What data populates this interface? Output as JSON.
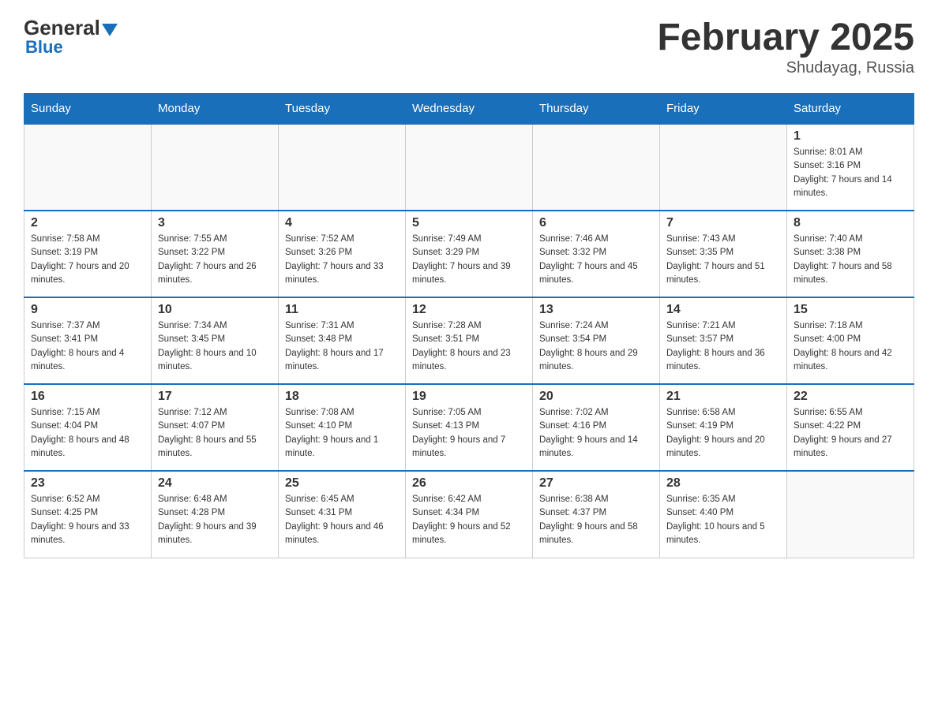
{
  "header": {
    "logo": {
      "general": "General",
      "blue": "Blue",
      "underline": "Blue"
    },
    "title": "February 2025",
    "location": "Shudayag, Russia"
  },
  "days_of_week": [
    "Sunday",
    "Monday",
    "Tuesday",
    "Wednesday",
    "Thursday",
    "Friday",
    "Saturday"
  ],
  "weeks": [
    [
      null,
      null,
      null,
      null,
      null,
      null,
      {
        "day": "1",
        "sunrise": "Sunrise: 8:01 AM",
        "sunset": "Sunset: 3:16 PM",
        "daylight": "Daylight: 7 hours and 14 minutes."
      }
    ],
    [
      {
        "day": "2",
        "sunrise": "Sunrise: 7:58 AM",
        "sunset": "Sunset: 3:19 PM",
        "daylight": "Daylight: 7 hours and 20 minutes."
      },
      {
        "day": "3",
        "sunrise": "Sunrise: 7:55 AM",
        "sunset": "Sunset: 3:22 PM",
        "daylight": "Daylight: 7 hours and 26 minutes."
      },
      {
        "day": "4",
        "sunrise": "Sunrise: 7:52 AM",
        "sunset": "Sunset: 3:26 PM",
        "daylight": "Daylight: 7 hours and 33 minutes."
      },
      {
        "day": "5",
        "sunrise": "Sunrise: 7:49 AM",
        "sunset": "Sunset: 3:29 PM",
        "daylight": "Daylight: 7 hours and 39 minutes."
      },
      {
        "day": "6",
        "sunrise": "Sunrise: 7:46 AM",
        "sunset": "Sunset: 3:32 PM",
        "daylight": "Daylight: 7 hours and 45 minutes."
      },
      {
        "day": "7",
        "sunrise": "Sunrise: 7:43 AM",
        "sunset": "Sunset: 3:35 PM",
        "daylight": "Daylight: 7 hours and 51 minutes."
      },
      {
        "day": "8",
        "sunrise": "Sunrise: 7:40 AM",
        "sunset": "Sunset: 3:38 PM",
        "daylight": "Daylight: 7 hours and 58 minutes."
      }
    ],
    [
      {
        "day": "9",
        "sunrise": "Sunrise: 7:37 AM",
        "sunset": "Sunset: 3:41 PM",
        "daylight": "Daylight: 8 hours and 4 minutes."
      },
      {
        "day": "10",
        "sunrise": "Sunrise: 7:34 AM",
        "sunset": "Sunset: 3:45 PM",
        "daylight": "Daylight: 8 hours and 10 minutes."
      },
      {
        "day": "11",
        "sunrise": "Sunrise: 7:31 AM",
        "sunset": "Sunset: 3:48 PM",
        "daylight": "Daylight: 8 hours and 17 minutes."
      },
      {
        "day": "12",
        "sunrise": "Sunrise: 7:28 AM",
        "sunset": "Sunset: 3:51 PM",
        "daylight": "Daylight: 8 hours and 23 minutes."
      },
      {
        "day": "13",
        "sunrise": "Sunrise: 7:24 AM",
        "sunset": "Sunset: 3:54 PM",
        "daylight": "Daylight: 8 hours and 29 minutes."
      },
      {
        "day": "14",
        "sunrise": "Sunrise: 7:21 AM",
        "sunset": "Sunset: 3:57 PM",
        "daylight": "Daylight: 8 hours and 36 minutes."
      },
      {
        "day": "15",
        "sunrise": "Sunrise: 7:18 AM",
        "sunset": "Sunset: 4:00 PM",
        "daylight": "Daylight: 8 hours and 42 minutes."
      }
    ],
    [
      {
        "day": "16",
        "sunrise": "Sunrise: 7:15 AM",
        "sunset": "Sunset: 4:04 PM",
        "daylight": "Daylight: 8 hours and 48 minutes."
      },
      {
        "day": "17",
        "sunrise": "Sunrise: 7:12 AM",
        "sunset": "Sunset: 4:07 PM",
        "daylight": "Daylight: 8 hours and 55 minutes."
      },
      {
        "day": "18",
        "sunrise": "Sunrise: 7:08 AM",
        "sunset": "Sunset: 4:10 PM",
        "daylight": "Daylight: 9 hours and 1 minute."
      },
      {
        "day": "19",
        "sunrise": "Sunrise: 7:05 AM",
        "sunset": "Sunset: 4:13 PM",
        "daylight": "Daylight: 9 hours and 7 minutes."
      },
      {
        "day": "20",
        "sunrise": "Sunrise: 7:02 AM",
        "sunset": "Sunset: 4:16 PM",
        "daylight": "Daylight: 9 hours and 14 minutes."
      },
      {
        "day": "21",
        "sunrise": "Sunrise: 6:58 AM",
        "sunset": "Sunset: 4:19 PM",
        "daylight": "Daylight: 9 hours and 20 minutes."
      },
      {
        "day": "22",
        "sunrise": "Sunrise: 6:55 AM",
        "sunset": "Sunset: 4:22 PM",
        "daylight": "Daylight: 9 hours and 27 minutes."
      }
    ],
    [
      {
        "day": "23",
        "sunrise": "Sunrise: 6:52 AM",
        "sunset": "Sunset: 4:25 PM",
        "daylight": "Daylight: 9 hours and 33 minutes."
      },
      {
        "day": "24",
        "sunrise": "Sunrise: 6:48 AM",
        "sunset": "Sunset: 4:28 PM",
        "daylight": "Daylight: 9 hours and 39 minutes."
      },
      {
        "day": "25",
        "sunrise": "Sunrise: 6:45 AM",
        "sunset": "Sunset: 4:31 PM",
        "daylight": "Daylight: 9 hours and 46 minutes."
      },
      {
        "day": "26",
        "sunrise": "Sunrise: 6:42 AM",
        "sunset": "Sunset: 4:34 PM",
        "daylight": "Daylight: 9 hours and 52 minutes."
      },
      {
        "day": "27",
        "sunrise": "Sunrise: 6:38 AM",
        "sunset": "Sunset: 4:37 PM",
        "daylight": "Daylight: 9 hours and 58 minutes."
      },
      {
        "day": "28",
        "sunrise": "Sunrise: 6:35 AM",
        "sunset": "Sunset: 4:40 PM",
        "daylight": "Daylight: 10 hours and 5 minutes."
      },
      null
    ]
  ]
}
